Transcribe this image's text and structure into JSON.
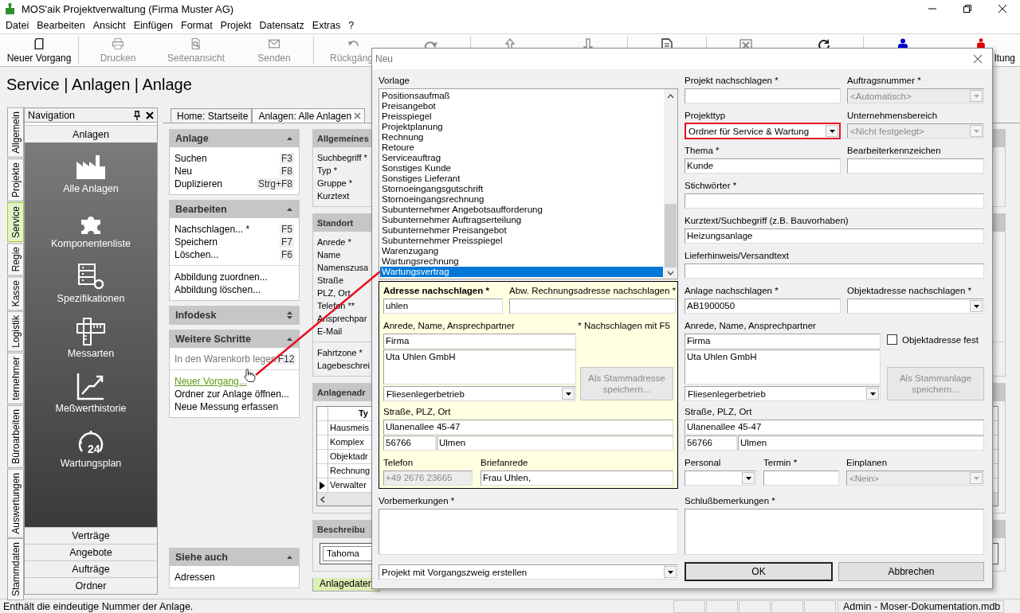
{
  "window": {
    "title": "MOS'aik Projektverwaltung (Firma Muster AG)"
  },
  "menu": [
    "Datei",
    "Bearbeiten",
    "Ansicht",
    "Einfügen",
    "Format",
    "Projekt",
    "Datensatz",
    "Extras",
    "?"
  ],
  "toolbar": [
    [
      {
        "kind": "document",
        "label": "Neuer Vorgang",
        "disabled": false
      }
    ],
    [
      {
        "kind": "printer",
        "label": "Drucken",
        "disabled": true
      },
      {
        "kind": "preview",
        "label": "Seitenansicht",
        "disabled": true
      },
      {
        "kind": "mail",
        "label": "Senden",
        "disabled": true
      }
    ],
    [
      {
        "kind": "undo",
        "label": "Rückgäng",
        "disabled": true
      },
      {
        "kind": "redo",
        "disabled": true
      }
    ],
    [
      {
        "kind": "up",
        "disabled": true
      },
      {
        "kind": "down",
        "disabled": true
      }
    ],
    [
      {
        "kind": "report",
        "disabled": false
      }
    ],
    [
      {
        "kind": "delete",
        "disabled": true
      },
      {
        "kind": "refresh",
        "disabled": false
      }
    ],
    [
      {
        "kind": "person",
        "color": "#0000cc"
      },
      {
        "kind": "person",
        "color": "#e00000",
        "label": "ltung"
      }
    ]
  ],
  "page_title": "Service | Anlagen | Anlage",
  "side_tabs": [
    {
      "label": "Allgemein",
      "selected": false
    },
    {
      "label": "Projekte",
      "selected": false
    },
    {
      "label": "Service",
      "selected": true
    },
    {
      "label": "Regie",
      "selected": false
    },
    {
      "label": "Kasse",
      "selected": false
    },
    {
      "label": "Logistik",
      "selected": false
    },
    {
      "label": "ternehmer",
      "selected": false
    },
    {
      "label": "Büroarbeiten",
      "selected": false
    },
    {
      "label": "Auswertungen",
      "selected": false
    },
    {
      "label": "Stammdaten",
      "selected": false
    }
  ],
  "navigation": {
    "title": "Navigation",
    "group": "Anlagen",
    "items": [
      {
        "kind": "factory",
        "label": "Alle Anlagen"
      },
      {
        "kind": "puzzle",
        "label": "Komponentenliste"
      },
      {
        "kind": "spec",
        "label": "Spezifikationen"
      },
      {
        "kind": "ruler",
        "label": "Messarten"
      },
      {
        "kind": "chart",
        "label": "Meßwerthistorie"
      },
      {
        "kind": "clock",
        "icon_text": "24",
        "label": "Wartungsplan"
      }
    ],
    "sections": [
      "Verträge",
      "Angebote",
      "Aufträge",
      "Ordner"
    ]
  },
  "doc_tabs": [
    {
      "label": "Home: Startseite",
      "selected": false,
      "closable": false
    },
    {
      "label": "Anlagen: Alle Anlagen",
      "selected": true,
      "closable": true
    }
  ],
  "tasks": [
    {
      "title": "Anlage",
      "expanded": true,
      "groups": [
        [
          {
            "label": "Suchen",
            "key": "F3",
            "kind": "command"
          },
          {
            "label": "Neu",
            "key": "F8",
            "kind": "command"
          },
          {
            "label": "Duplizieren",
            "key": "Strg+F8",
            "kind": "command"
          }
        ]
      ]
    },
    {
      "title": "Bearbeiten",
      "expanded": true,
      "groups": [
        [
          {
            "label": "Nachschlagen... *",
            "key": "F5",
            "kind": "command"
          },
          {
            "label": "Speichern",
            "key": "F7",
            "kind": "command"
          },
          {
            "label": "Löschen...",
            "key": "F6",
            "kind": "command"
          }
        ],
        [
          {
            "label": "Abbildung zuordnen...",
            "kind": "command"
          },
          {
            "label": "Abbildung löschen...",
            "kind": "command"
          }
        ]
      ]
    },
    {
      "title": "Infodesk",
      "expanded": false
    },
    {
      "title": "Weitere Schritte",
      "expanded": true,
      "groups": [
        [
          {
            "label": "In den Warenkorb legen",
            "key": "F12",
            "kind": "disabled"
          }
        ],
        [
          {
            "label": "Neuer Vorgang...",
            "kind": "link"
          },
          {
            "label": "Ordner zur Anlage öffnen...",
            "kind": "command"
          },
          {
            "label": "Neue Messung erfassen",
            "kind": "command"
          }
        ]
      ]
    },
    {
      "title": "Siehe auch",
      "expanded": true,
      "groups": [
        [
          {
            "label": "Adressen",
            "kind": "command"
          }
        ]
      ]
    }
  ],
  "form": {
    "sections": [
      {
        "title": "Allgemeines",
        "kind": "fields",
        "groups": [
          [
            "Suchbegriff *",
            "Typ *",
            "Gruppe *",
            "Kurztext"
          ]
        ]
      },
      {
        "title": "Standort",
        "kind": "fields",
        "groups": [
          [
            "Anrede *",
            "Name",
            "Namenszusa",
            "Straße",
            "PLZ, Ort",
            "Telefon **",
            "Ansprechpar",
            "E-Mail"
          ],
          [
            "Fahrtzone *",
            "Lagebeschrei"
          ]
        ]
      },
      {
        "title": "Anlagenadr",
        "kind": "grid",
        "header": "Ty",
        "rows": [
          {
            "cell": "Hausmeis",
            "selected": false
          },
          {
            "cell": "Komplex",
            "selected": false
          },
          {
            "cell": "Objektadr",
            "selected": false
          },
          {
            "cell": "Rechnung",
            "selected": false
          },
          {
            "cell": "Verwalter",
            "selected": true
          }
        ]
      },
      {
        "title": "Beschreibu",
        "kind": "editor",
        "font": "Tahoma"
      }
    ],
    "tabs": [
      {
        "label": "Anlagedaten",
        "selected": true
      }
    ]
  },
  "status_bar": {
    "text": "Enthält die eindeutige Nummer der Anlage.",
    "right": "Admin - Moser-Dokumentation.mdb"
  },
  "dialog": {
    "title": "Neu",
    "template": {
      "label": "Vorlage",
      "items": [
        {
          "label": "Positionsaufmaß",
          "selected": false
        },
        {
          "label": "Preisangebot",
          "selected": false
        },
        {
          "label": "Preisspiegel",
          "selected": false
        },
        {
          "label": "Projektplanung",
          "selected": false
        },
        {
          "label": "Rechnung",
          "selected": false
        },
        {
          "label": "Retoure",
          "selected": false
        },
        {
          "label": "Serviceauftrag",
          "selected": false
        },
        {
          "label": "Sonstiges Kunde",
          "selected": false
        },
        {
          "label": "Sonstiges Lieferant",
          "selected": false
        },
        {
          "label": "Stornoeingangsgutschrift",
          "selected": false
        },
        {
          "label": "Stornoeingangsrechnung",
          "selected": false
        },
        {
          "label": "Subunternehmer Angebotsaufforderung",
          "selected": false
        },
        {
          "label": "Subunternehmer Auftragserteilung",
          "selected": false
        },
        {
          "label": "Subunternehmer Preisangebot",
          "selected": false
        },
        {
          "label": "Subunternehmer Preisspiegel",
          "selected": false
        },
        {
          "label": "Warenzugang",
          "selected": false
        },
        {
          "label": "Wartungsrechnung",
          "selected": false
        },
        {
          "label": "Wartungsvertrag",
          "selected": true
        }
      ]
    },
    "address": {
      "lookup": {
        "label": "Adresse nachschlagen *",
        "value": "uhlen"
      },
      "billing_lookup": {
        "label": "Abw. Rechnungsadresse nachschlagen *"
      },
      "name_label": "Anrede, Name, Ansprechpartner",
      "hint": "* Nachschlagen mit F5",
      "salutation": {
        "value": "Firma"
      },
      "name": {
        "value": "Uta Uhlen GmbH"
      },
      "category": {
        "value": "Fliesenlegerbetrieb"
      },
      "save_button": {
        "label": "Als Stammadresse speichern...",
        "disabled": true
      },
      "street_label": "Straße, PLZ, Ort",
      "street": {
        "value": "Ulanenallee 45-47"
      },
      "zip": {
        "value": "56766"
      },
      "city": {
        "value": "Ulmen"
      },
      "phone": {
        "label": "Telefon",
        "value": "+49 2676 23665",
        "disabled": true
      },
      "letter_salutation": {
        "label": "Briefanrede",
        "value": "Frau Uhlen,"
      }
    },
    "preliminary_notes": {
      "label": "Vorbemerkungen *"
    },
    "create_mode": {
      "value": "Projekt mit Vorgangszweig erstellen"
    },
    "project_lookup": {
      "label": "Projekt nachschlagen *"
    },
    "order_number": {
      "label": "Auftragsnummer *",
      "value": "<Automatisch>",
      "disabled": true
    },
    "project_type": {
      "label": "Projekttyp",
      "value": "Ordner für Service & Wartung",
      "highlighted": true
    },
    "business_unit": {
      "label": "Unternehmensbereich",
      "value": "<Nicht festgelegt>",
      "disabled": true
    },
    "topic": {
      "label": "Thema *",
      "value": "Kunde"
    },
    "editor_code": {
      "label": "Bearbeiterkennzeichen"
    },
    "keywords": {
      "label": "Stichwörter *"
    },
    "short_text": {
      "label": "Kurztext/Suchbegriff (z.B. Bauvorhaben)",
      "value": "Heizungsanlage"
    },
    "delivery_note": {
      "label": "Lieferhinweis/Versandtext"
    },
    "plant_lookup": {
      "label": "Anlage nachschlagen *",
      "value": "AB1900050"
    },
    "object_address_lookup": {
      "label": "Objektadresse nachschlagen *"
    },
    "object_address": {
      "name_label": "Anrede, Name, Ansprechpartner",
      "salutation": {
        "value": "Firma"
      },
      "name": {
        "value": "Uta Uhlen GmbH"
      },
      "category": {
        "value": "Fliesenlegerbetrieb"
      },
      "fixed": {
        "label": "Objektadresse fest",
        "checked": false
      },
      "save_button": {
        "label": "Als Stammanlage speichern...",
        "disabled": true
      },
      "street_label": "Straße, PLZ, Ort",
      "street": {
        "value": "Ulanenallee 45-47"
      },
      "zip": {
        "value": "56766"
      },
      "city": {
        "value": "Ulmen"
      }
    },
    "staff": {
      "label": "Personal"
    },
    "appointment": {
      "label": "Termin *"
    },
    "schedule": {
      "label": "Einplanen",
      "value": "<Nein>",
      "disabled": true
    },
    "closing_notes": {
      "label": "Schlußbemerkungen *"
    },
    "buttons": [
      {
        "label": "OK",
        "default": true
      },
      {
        "label": "Abbrechen",
        "default": false
      }
    ]
  }
}
